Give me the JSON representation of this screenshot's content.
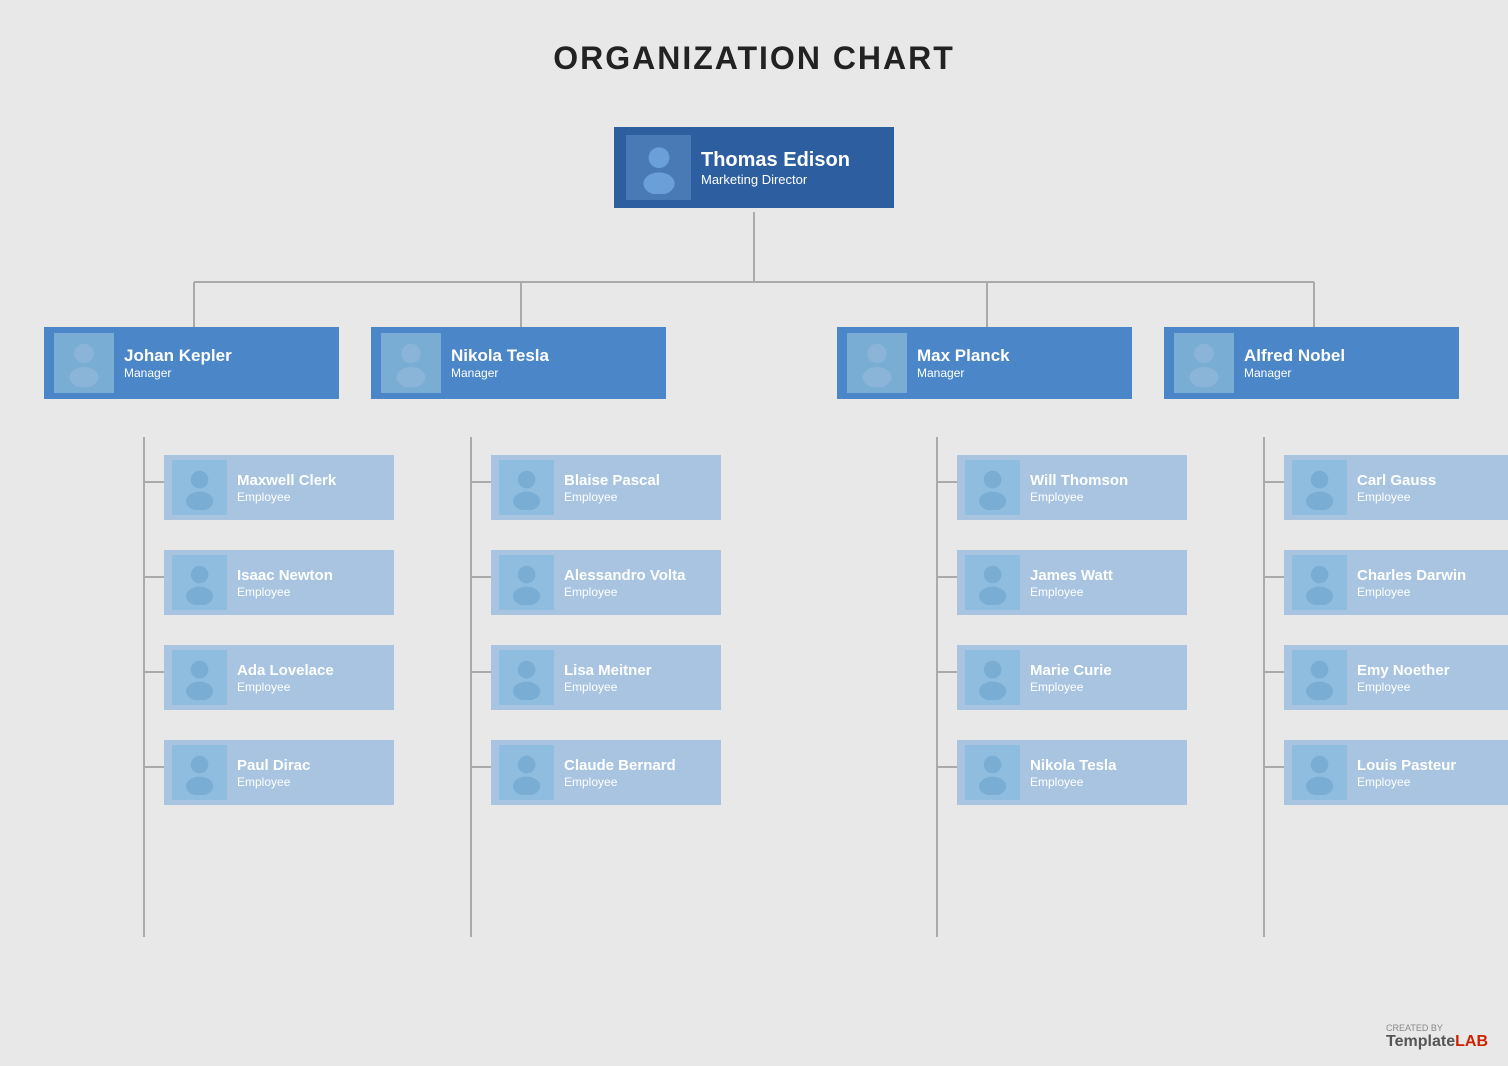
{
  "title": "ORGANIZATION CHART",
  "director": {
    "name": "Thomas Edison",
    "role": "Marketing Director"
  },
  "managers": [
    {
      "name": "Johan Kepler",
      "role": "Manager"
    },
    {
      "name": "Nikola Tesla",
      "role": "Manager"
    },
    {
      "name": "Max Planck",
      "role": "Manager"
    },
    {
      "name": "Alfred Nobel",
      "role": "Manager"
    }
  ],
  "employees": [
    [
      {
        "name": "Maxwell Clerk",
        "role": "Employee"
      },
      {
        "name": "Isaac Newton",
        "role": "Employee"
      },
      {
        "name": "Ada Lovelace",
        "role": "Employee"
      },
      {
        "name": "Paul Dirac",
        "role": "Employee"
      }
    ],
    [
      {
        "name": "Blaise Pascal",
        "role": "Employee"
      },
      {
        "name": "Alessandro Volta",
        "role": "Employee"
      },
      {
        "name": "Lisa Meitner",
        "role": "Employee"
      },
      {
        "name": "Claude Bernard",
        "role": "Employee"
      }
    ],
    [
      {
        "name": "Will Thomson",
        "role": "Employee"
      },
      {
        "name": "James Watt",
        "role": "Employee"
      },
      {
        "name": "Marie Curie",
        "role": "Employee"
      },
      {
        "name": "Nikola Tesla",
        "role": "Employee"
      }
    ],
    [
      {
        "name": "Carl Gauss",
        "role": "Employee"
      },
      {
        "name": "Charles Darwin",
        "role": "Employee"
      },
      {
        "name": "Emy Noether",
        "role": "Employee"
      },
      {
        "name": "Louis Pasteur",
        "role": "Employee"
      }
    ]
  ],
  "watermark": {
    "created_by": "CREATED BY",
    "template": "Template",
    "lab": "LAB"
  }
}
